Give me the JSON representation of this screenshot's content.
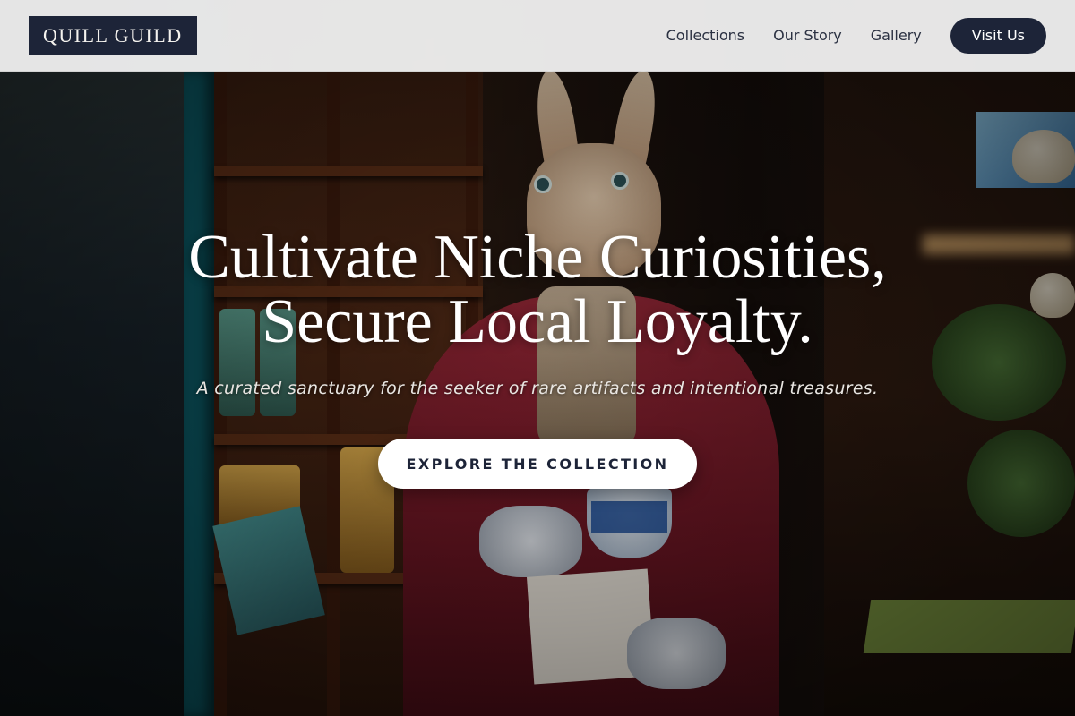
{
  "header": {
    "logo": "QUILL GUILD",
    "nav": [
      {
        "label": "Collections"
      },
      {
        "label": "Our Story"
      },
      {
        "label": "Gallery"
      }
    ],
    "cta_label": "Visit Us"
  },
  "hero": {
    "headline_line1": "Cultivate Niche Curiosities,",
    "headline_line2": "Secure Local Loyalty.",
    "subtitle": "A curated sanctuary for the seeker of rare artifacts and intentional treasures.",
    "cta_label": "EXPLORE THE COLLECTION",
    "background": "shop interior with rabbit figurine holding a teacup"
  },
  "colors": {
    "navy": "#1d2438",
    "header_bg": "#f6f6f6",
    "white": "#ffffff"
  }
}
